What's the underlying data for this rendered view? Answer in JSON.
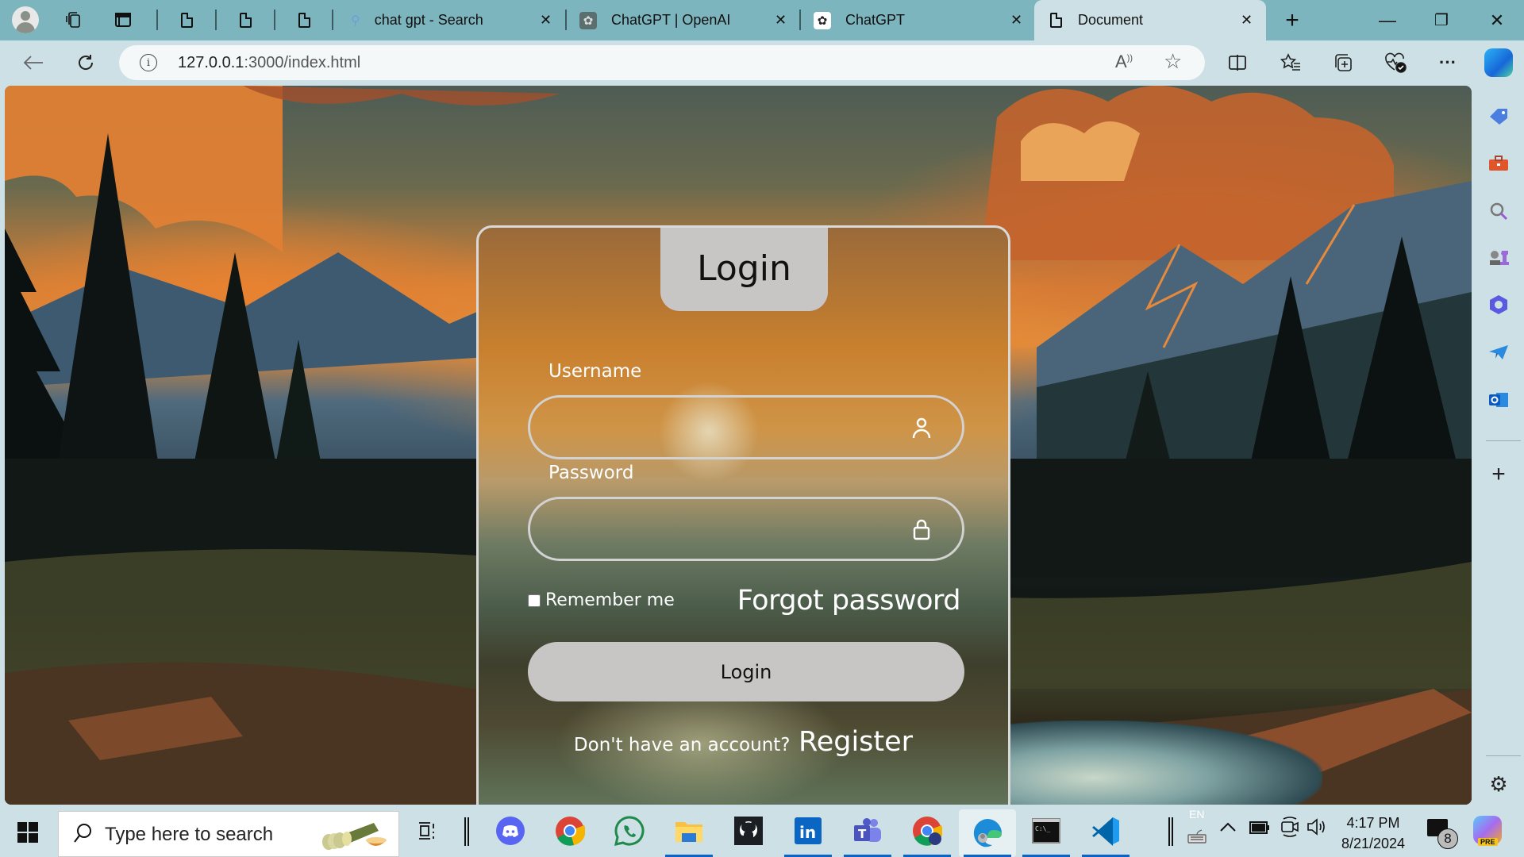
{
  "browser": {
    "tabs": [
      {
        "label": "chat gpt - Search",
        "icon": "search-icon",
        "active": false
      },
      {
        "label": "ChatGPT | OpenAI",
        "icon": "openai-logo-icon",
        "active": false
      },
      {
        "label": "ChatGPT",
        "icon": "openai-logo-icon",
        "active": false
      },
      {
        "label": "Document",
        "icon": "document-icon",
        "active": true
      }
    ],
    "new_tab_symbol": "+",
    "close_symbol": "✕",
    "window_controls": {
      "minimize": "—",
      "restore": "❐",
      "close": "✕"
    },
    "address": {
      "host": "127.0.0.1",
      "path": ":3000/index.html"
    },
    "read_aloud_symbol": "A",
    "favorite_symbol": "☆",
    "more_symbol": "···"
  },
  "login": {
    "title": "Login",
    "username_label": "Username",
    "username_value": "",
    "password_label": "Password",
    "password_value": "",
    "remember_label": "Remember me",
    "remember_checked": false,
    "forgot_label": "Forgot password",
    "submit_label": "Login",
    "register_prompt": "Don't have an account?",
    "register_label": "Register"
  },
  "sidebar": {
    "items": [
      "shopping-tag-icon",
      "tools-icon",
      "search-icon",
      "games-icon",
      "microsoft365-icon",
      "telegram-icon",
      "outlook-icon"
    ],
    "add_symbol": "+",
    "settings_symbol": "⚙"
  },
  "taskbar": {
    "search_placeholder": "Type here to search",
    "apps": [
      "task-view",
      "discord",
      "chrome",
      "whatsapp",
      "file-explorer",
      "github",
      "linkedin",
      "teams",
      "chrome-profile",
      "edge",
      "command-prompt",
      "vscode"
    ],
    "language": "EN",
    "time": "4:17 PM",
    "date": "8/21/2024",
    "notification_count": "8",
    "copilot_badge": "PRE"
  }
}
